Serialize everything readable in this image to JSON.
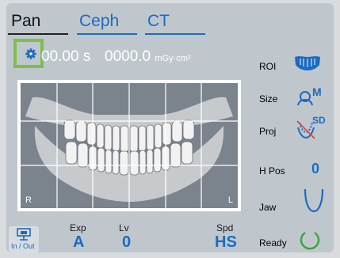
{
  "tabs": [
    {
      "label": "Pan"
    },
    {
      "label": "Ceph"
    },
    {
      "label": "CT"
    }
  ],
  "readout": {
    "time": "00.00 s",
    "dose": "0000.0",
    "dose_unit": "mGy·cm²"
  },
  "corners": {
    "left": "R",
    "right": "L"
  },
  "side": {
    "roi_label": "ROI",
    "size_label": "Size",
    "size_value": "M",
    "proj_label": "Proj",
    "proj_value": "SD",
    "hpos_label": "H Pos",
    "hpos_value": "0",
    "jaw_label": "Jaw",
    "ready_label": "Ready"
  },
  "bottom": {
    "inout_label": "In / Out",
    "exp_label": "Exp",
    "exp_value": "A",
    "lv_label": "Lv",
    "lv_value": "0",
    "spd_label": "Spd",
    "spd_value": "HS"
  },
  "colors": {
    "accent_blue": "#1b6ac6",
    "highlight_green": "#7cc04a",
    "ready_green": "#3aa43a",
    "background": "#bfc7cd"
  }
}
